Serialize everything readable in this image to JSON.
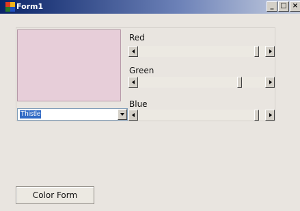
{
  "window": {
    "title": "Form1",
    "minimize_glyph": "_",
    "maximize_glyph": "□",
    "close_glyph": "×"
  },
  "colors": {
    "preview": "#e7ced9",
    "titlebar_start": "#0a2468",
    "selection": "#316ac5"
  },
  "color_combo": {
    "selected": "Thistle"
  },
  "sliders": [
    {
      "label": "Red",
      "value_fraction": 0.95
    },
    {
      "label": "Green",
      "value_fraction": 0.81
    },
    {
      "label": "Blue",
      "value_fraction": 0.95
    }
  ],
  "color_form_button": {
    "label": "Color Form"
  }
}
